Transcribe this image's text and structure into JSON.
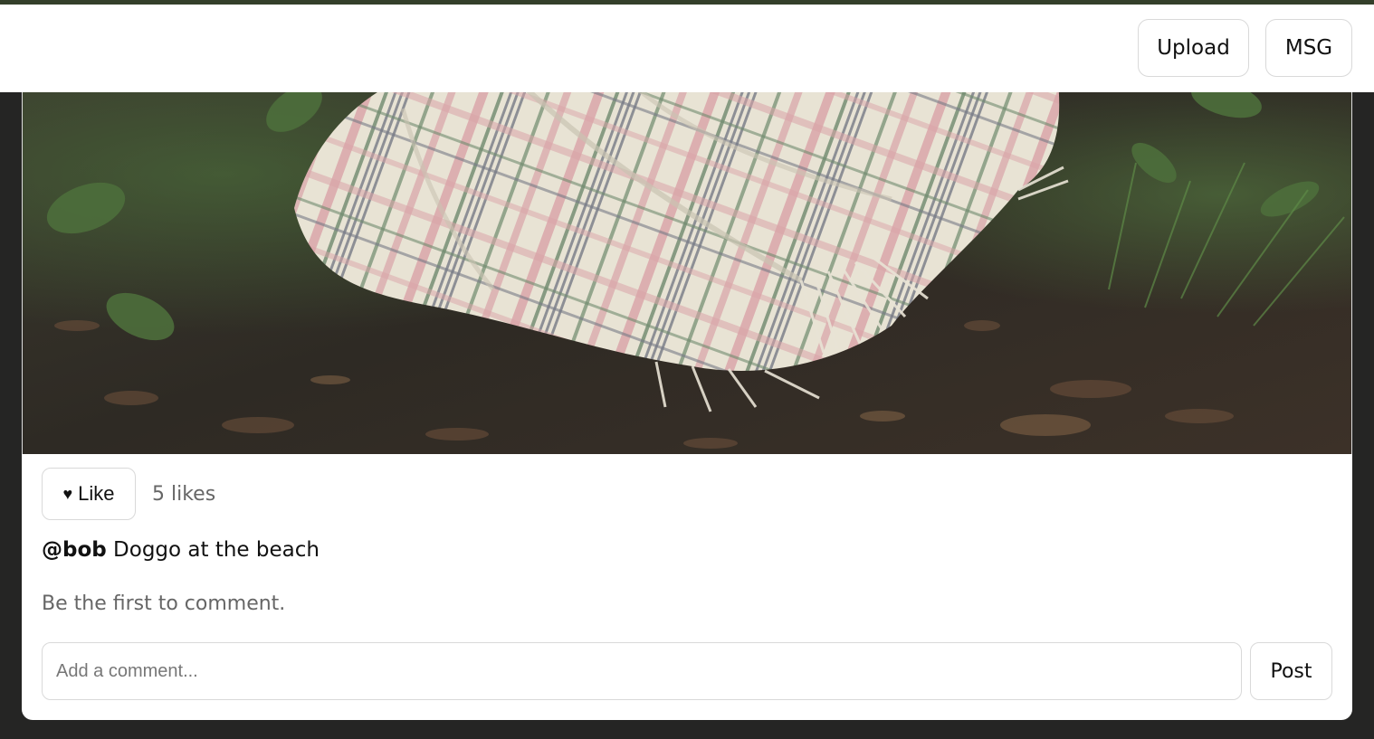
{
  "header": {
    "upload_label": "Upload",
    "msg_label": "MSG"
  },
  "post": {
    "image_icon": "photo-blanket-forest-floor",
    "like_label": "Like",
    "like_icon": "heart-icon",
    "likes_text": "5 likes",
    "caption_user": "@bob",
    "caption_text": "Doggo at the beach",
    "no_comments_text": "Be the first to comment.",
    "comment_placeholder": "Add a comment...",
    "comment_value": "",
    "post_label": "Post"
  },
  "colors": {
    "page_background": "#252524",
    "header_top_border": "#343f2a",
    "card_background": "#ffffff",
    "muted_text": "#666666"
  }
}
